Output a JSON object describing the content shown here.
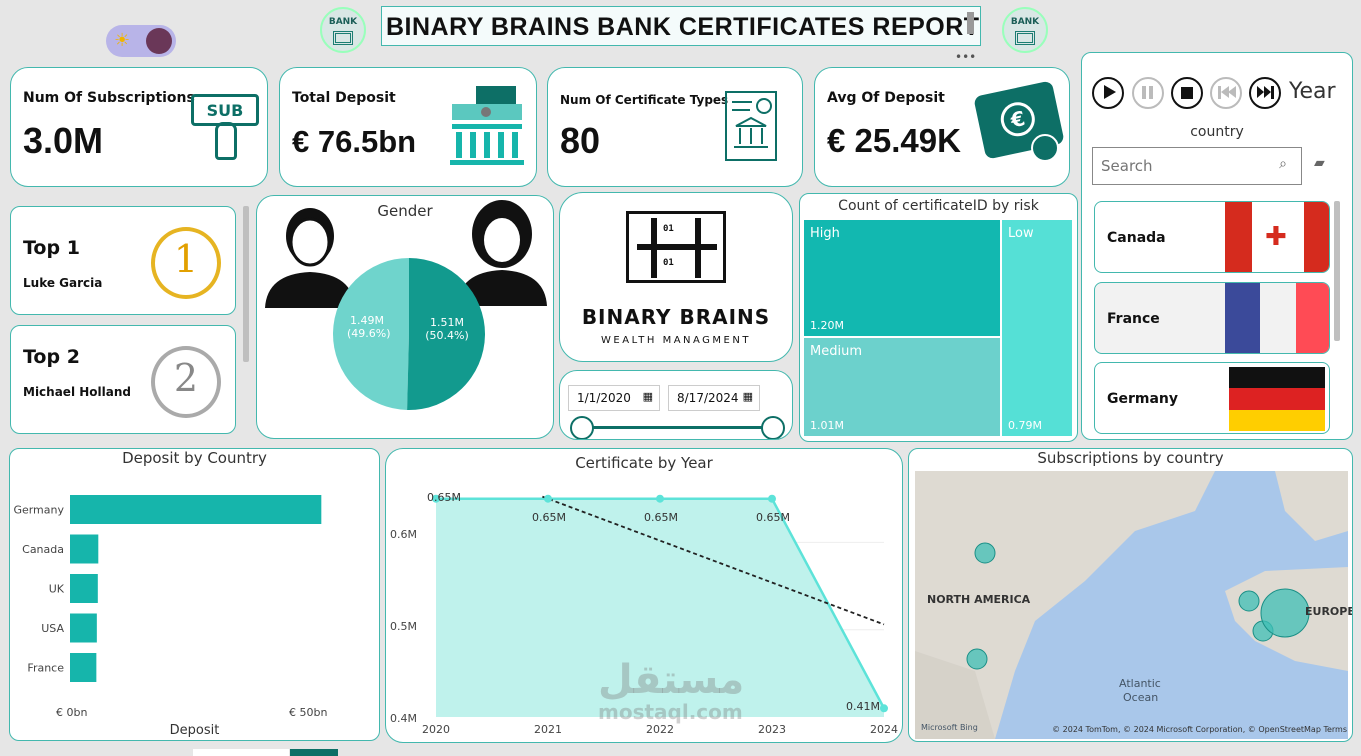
{
  "header": {
    "title": "BINARY BRAINS BANK CERTIFICATES REPORT",
    "bank_badge": "BANK",
    "more_dots": "•••"
  },
  "kpis": [
    {
      "title": "Num Of Subscriptions",
      "value": "3.0M",
      "icon_text": "SUB"
    },
    {
      "title": "Total Deposit",
      "value": "€ 76.5bn"
    },
    {
      "title": "Num Of Certificate Types",
      "value": "80"
    },
    {
      "title": "Avg Of Deposit",
      "value": "€ 25.49K",
      "icon_text": "€"
    }
  ],
  "top": [
    {
      "label": "Top 1",
      "name": "Luke Garcia",
      "medal": "1"
    },
    {
      "label": "Top 2",
      "name": "Michael Holland",
      "medal": "2"
    }
  ],
  "gender": {
    "title": "Gender",
    "slices": [
      {
        "value": "1.49M",
        "pct": "(49.6%)",
        "share": 0.496,
        "color": "#6fd4cc"
      },
      {
        "value": "1.51M",
        "pct": "(50.4%)",
        "share": 0.504,
        "color": "#129a8e"
      }
    ]
  },
  "logo": {
    "name": "BINARY BRAINS",
    "tagline": "WEALTH MANAGMENT",
    "bits": "01"
  },
  "date_range": {
    "start": "1/1/2020",
    "end": "8/17/2024"
  },
  "risk": {
    "title": "Count of certificateID by risk",
    "cells": [
      {
        "label": "High",
        "value": "1.20M",
        "color": "#12b8b0"
      },
      {
        "label": "Medium",
        "value": "1.01M",
        "color": "#6cd1cc"
      },
      {
        "label": "Low",
        "value": "0.79M",
        "color": "#55e0d6"
      }
    ]
  },
  "filters": {
    "year_label": "Year",
    "country_label": "country",
    "search_placeholder": "Search",
    "countries": [
      "Canada",
      "France",
      "Germany"
    ]
  },
  "chart_data": [
    {
      "type": "bar",
      "title": "Deposit by Country",
      "xlabel": "Deposit",
      "categories": [
        "Germany",
        "Canada",
        "UK",
        "USA",
        "France"
      ],
      "values": [
        51.5,
        5.8,
        5.7,
        5.5,
        5.4
      ],
      "xlim": [
        0,
        50
      ],
      "xticks": [
        "€ 0bn",
        "€ 50bn"
      ],
      "color": "#16b5ab"
    },
    {
      "type": "area",
      "title": "Certificate by Year",
      "x": [
        2020,
        2021,
        2022,
        2023,
        2024
      ],
      "values": [
        0.65,
        0.65,
        0.65,
        0.65,
        0.41
      ],
      "labels": [
        "0.65M",
        "0.65M",
        "0.65M",
        "0.65M",
        "0.41M"
      ],
      "ylim": [
        0.4,
        0.66
      ],
      "yticks": [
        "0.6M",
        "0.5M",
        "0.4M"
      ],
      "trend": true,
      "color": "#5de3d9"
    },
    {
      "type": "map",
      "title": "Subscriptions by country",
      "regions": [
        "NORTH AMERICA",
        "EUROPE",
        "Atlantic",
        "Ocean"
      ],
      "credit": "© 2024 TomTom, © 2024 Microsoft Corporation, © OpenStreetMap  Terms",
      "brand": "Microsoft Bing"
    }
  ],
  "watermark": {
    "arabic": "مستقل",
    "latin": "mostaql.com"
  },
  "colors": {
    "accent": "#43b8ae",
    "teal": "#16b5ab",
    "dark_teal": "#0f6f66"
  }
}
